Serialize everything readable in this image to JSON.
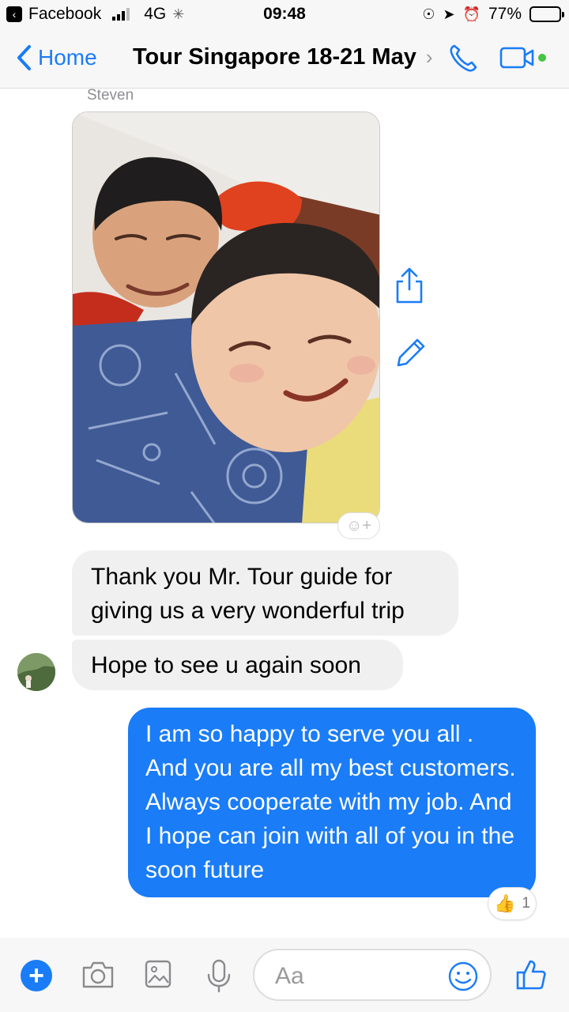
{
  "status_bar": {
    "back_app": "Facebook",
    "network": "4G",
    "time": "09:48",
    "battery": "77%",
    "battery_level": 0.77
  },
  "nav": {
    "back_label": "Home",
    "title": "Tour Singapore 18-21 May",
    "accent_color": "#1a7cf7"
  },
  "conversation": {
    "sender_name": "Steven",
    "messages": [
      {
        "from": "received",
        "text": "Thank you Mr. Tour guide for giving us a very wonderful trip"
      },
      {
        "from": "received",
        "text": "Hope to see u again soon"
      },
      {
        "from": "sent",
        "text": "I am so happy to serve you all . And you are all my best customers. Always cooperate with my job. And I hope can join with all of you in the soon future"
      }
    ],
    "sent_reaction": {
      "icon": "thumbs-up-emoji",
      "count": "1"
    }
  },
  "composer": {
    "placeholder": "Aa"
  }
}
